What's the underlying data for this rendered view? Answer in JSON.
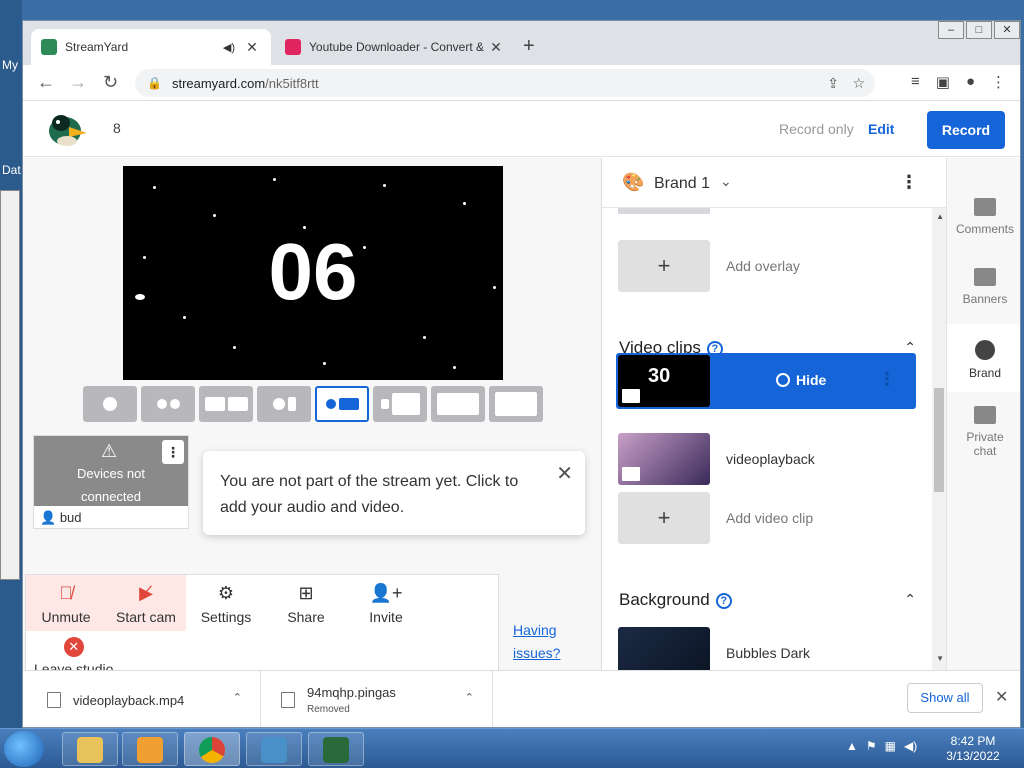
{
  "desktop": {
    "label_top": "My",
    "label_mid": "Dat"
  },
  "browser": {
    "tabs": [
      {
        "title": "StreamYard",
        "active": true
      },
      {
        "title": "Youtube Downloader - Convert & Download",
        "active": false
      }
    ],
    "url_domain": "streamyard.com",
    "url_path": "/nk5itf8rtt"
  },
  "header": {
    "viewer_count": "8",
    "record_only": "Record only",
    "edit": "Edit",
    "record": "Record"
  },
  "stage": {
    "countdown": "06"
  },
  "device_tile": {
    "status_line1": "Devices not",
    "status_line2": "connected",
    "name": "bud"
  },
  "notice": {
    "text": "You are not part of the stream yet. Click to add your audio and video."
  },
  "controls": {
    "unmute": "Unmute",
    "start_cam": "Start cam",
    "settings": "Settings",
    "share": "Share",
    "invite": "Invite",
    "leave": "Leave studio",
    "issues_line1": "Having",
    "issues_line2": "issues?"
  },
  "brand_panel": {
    "brand_name": "Brand 1",
    "add_overlay": "Add overlay",
    "video_clips_title": "Video clips",
    "active_clip_number": "30",
    "hide": "Hide",
    "clip_name": "videoplayback",
    "add_video_clip": "Add video clip",
    "background_title": "Background",
    "background_name": "Bubbles Dark"
  },
  "rail": {
    "comments": "Comments",
    "banners": "Banners",
    "brand": "Brand",
    "private_chat_line1": "Private",
    "private_chat_line2": "chat"
  },
  "downloads": {
    "items": [
      {
        "name": "videoplayback.mp4",
        "sub": ""
      },
      {
        "name": "94mqhp.pingas",
        "sub": "Removed"
      }
    ],
    "show_all": "Show all"
  },
  "taskbar": {
    "time": "8:42 PM",
    "date": "3/13/2022"
  },
  "colors": {
    "accent": "#1565d8",
    "danger": "#e0463a",
    "stage_bg": "#000000"
  }
}
